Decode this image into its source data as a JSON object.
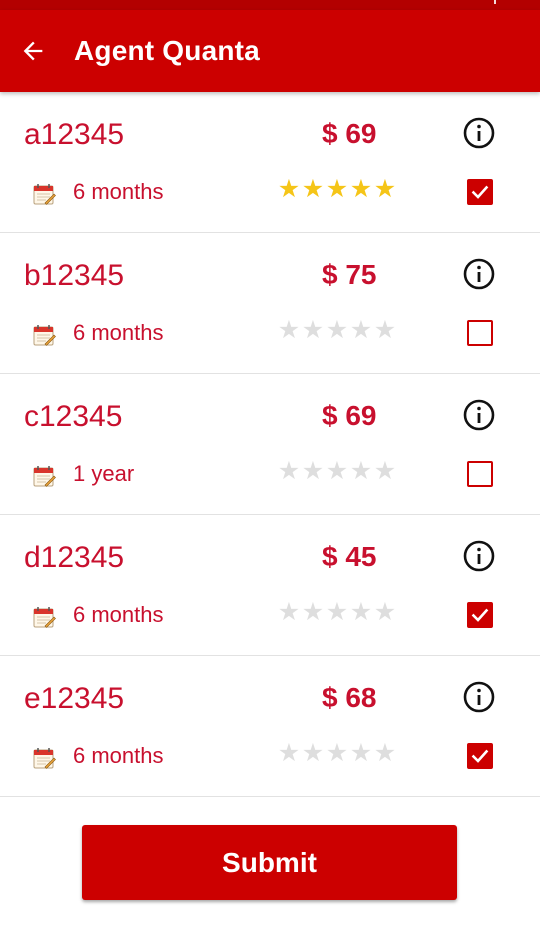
{
  "app_bar": {
    "title": "Agent Quanta",
    "back_icon": "arrow-left-icon",
    "background": "#cc0000"
  },
  "colors": {
    "accent": "#cc0000",
    "text_accent": "#c8102e",
    "star_filled": "#f5c518",
    "star_empty": "#dedede"
  },
  "plans": [
    {
      "code": "a12345",
      "price": "$ 69",
      "duration": "6 months",
      "rating": 5,
      "checked": true
    },
    {
      "code": "b12345",
      "price": "$ 75",
      "duration": "6 months",
      "rating": 0,
      "checked": false
    },
    {
      "code": "c12345",
      "price": "$ 69",
      "duration": "1 year",
      "rating": 0,
      "checked": false
    },
    {
      "code": "d12345",
      "price": "$ 45",
      "duration": "6 months",
      "rating": 0,
      "checked": true
    },
    {
      "code": "e12345",
      "price": "$ 68",
      "duration": "6 months",
      "rating": 0,
      "checked": true
    }
  ],
  "rating_max": 5,
  "icons": {
    "info": "info-circle-icon",
    "calendar": "calendar-icon",
    "checkmark": "checkmark-icon"
  },
  "submit": {
    "label": "Submit"
  }
}
